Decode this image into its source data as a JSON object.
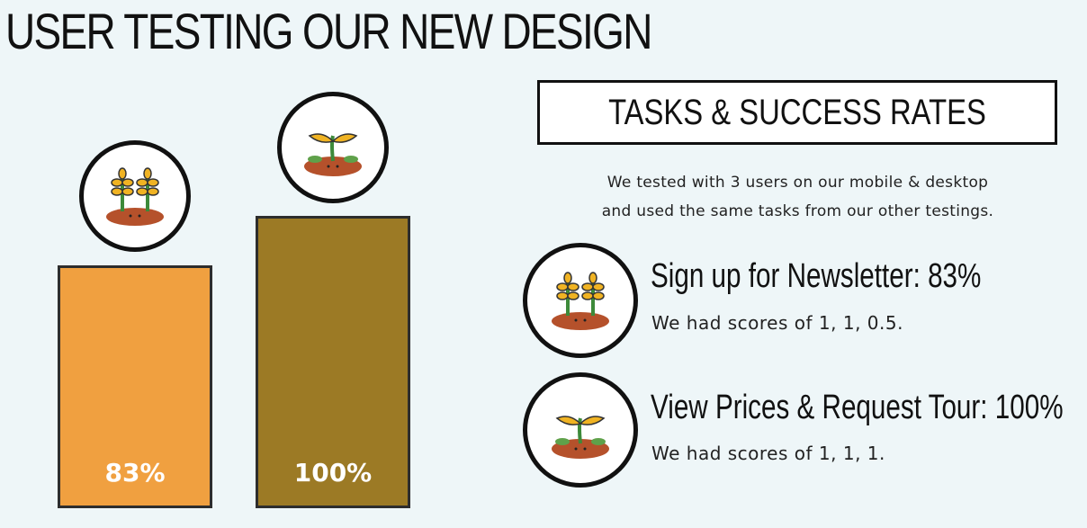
{
  "title": "USER TESTING OUR NEW DESIGN",
  "panel": {
    "heading": "TASKS & SUCCESS RATES",
    "intro_line1": "We tested with 3 users on our mobile & desktop",
    "intro_line2": "and used the same tasks from our other testings."
  },
  "tasks": [
    {
      "title": "Sign up for Newsletter: 83%",
      "desc": "We had scores of 1, 1, 0.5.",
      "icon": "wheat-sprout-icon"
    },
    {
      "title": "View Prices & Request Tour: 100%",
      "desc": "We had scores of 1, 1, 1.",
      "icon": "seedling-icon"
    }
  ],
  "chart_data": {
    "type": "bar",
    "categories": [
      "",
      ""
    ],
    "values": [
      83,
      100
    ],
    "value_labels": [
      "83%",
      "100%"
    ],
    "colors": [
      "#f0a040",
      "#9c7a25"
    ],
    "ylim": [
      0,
      100
    ]
  }
}
